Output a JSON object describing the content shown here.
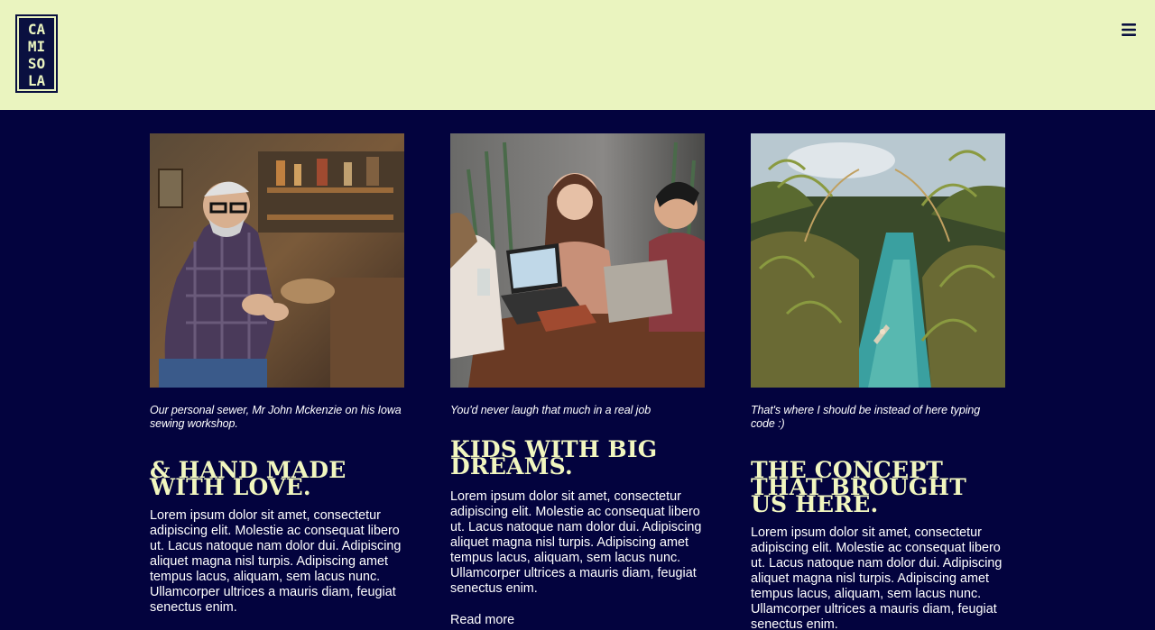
{
  "header": {
    "logo_letters": [
      "CA",
      "MI",
      "SO",
      "LA"
    ],
    "menu_icon": "hamburger-menu-icon",
    "colors": {
      "background": "#eaf4bf",
      "ink": "#0a1040"
    }
  },
  "page": {
    "colors": {
      "background": "#03033e",
      "heading": "#f1f6bf",
      "text": "#ffffff"
    }
  },
  "cards": [
    {
      "image": "photo-old-man-sewing-in-workshop",
      "caption": "Our personal sewer, Mr John Mckenzie on his Iowa sewing workshop.",
      "title": "& HAND MADE WITH LOVE.",
      "body": "Lorem ipsum dolor sit amet, consectetur adipiscing elit. Molestie ac consequat libero ut. Lacus natoque nam dolor dui. Adipiscing aliquet magna nisl turpis. Adipiscing amet tempus lacus, aliquam, sem lacus nunc. Ullamcorper ultrices a mauris diam, feugiat senectus enim."
    },
    {
      "image": "photo-people-laughing-at-laptops",
      "caption": "You'd never laugh that much in a real job",
      "title": "KIDS WITH BIG DREAMS.",
      "body": "Lorem ipsum dolor sit amet, consectetur adipiscing elit. Molestie ac consequat libero ut. Lacus natoque nam dolor dui. Adipiscing aliquet magna nisl turpis. Adipiscing amet tempus lacus, aliquam, sem lacus nunc. Ullamcorper ultrices a mauris diam, feugiat senectus enim.",
      "link": "Read more"
    },
    {
      "image": "photo-river-with-palm-trees",
      "caption": "That's where I should be instead of here typing code :)",
      "title": "THE CONCEPT THAT BROUGHT US HERE.",
      "body": "Lorem ipsum dolor sit amet, consectetur adipiscing elit. Molestie ac consequat libero ut. Lacus natoque nam dolor dui. Adipiscing aliquet magna nisl turpis. Adipiscing amet tempus lacus, aliquam, sem lacus nunc. Ullamcorper ultrices a mauris diam, feugiat senectus enim."
    }
  ]
}
